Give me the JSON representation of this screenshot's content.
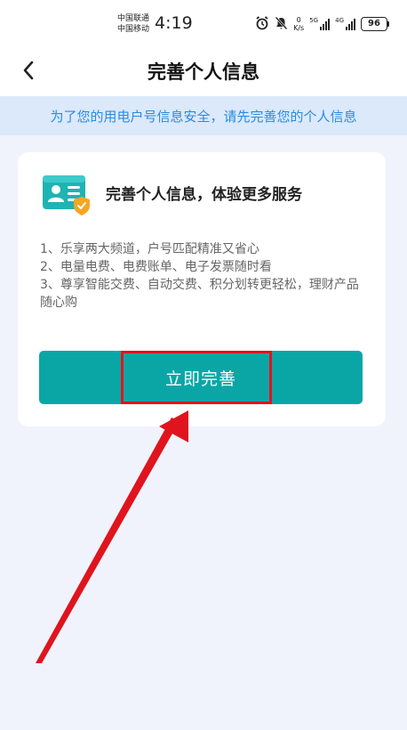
{
  "status_bar": {
    "carrier_1": "中国联通",
    "carrier_2": "中国移动",
    "time": "4:19",
    "net_speed_value": "0",
    "net_speed_unit": "K/s",
    "network_1": "5G",
    "network_2": "4G",
    "battery": "96"
  },
  "nav": {
    "title": "完善个人信息",
    "back_icon": "chevron-left-icon"
  },
  "notice": {
    "text": "为了您的用电户号信息安全，请先完善您的个人信息"
  },
  "card": {
    "icon": "profile-card-shield-icon",
    "title": "完善个人信息，体验更多服务",
    "benefits": [
      "1、乐享两大频道，户号匹配精准又省心",
      "2、电量电费、电费账单、电子发票随时看",
      "3、尊享智能交费、自动交费、积分划转更轻松，理财产品随心购"
    ],
    "button_label": "立即完善"
  },
  "annotation": {
    "highlight_color": "#e0141e",
    "arrow_color": "#e0141e"
  },
  "colors": {
    "accent": "#0aa6a6",
    "notice_bg": "#dbe9fb",
    "notice_text": "#2a8be0",
    "page_bg": "#f0f3fb"
  }
}
